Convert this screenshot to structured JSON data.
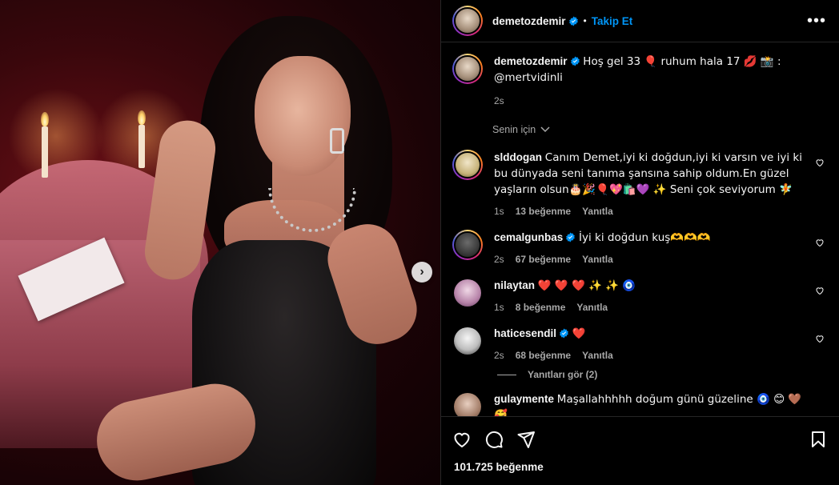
{
  "post": {
    "username": "demetozdemir",
    "follow_label": "Takip Et",
    "separator": "•",
    "more_label": "•••",
    "caption": "Hoş gel 33 🎈 ruhum hala 17 💋 📸 : @mertvidinli",
    "caption_time": "2s",
    "for_you_label": "Senin için",
    "likes_text": "101.725 beğenme",
    "next_label": "›"
  },
  "comments": [
    {
      "username": "slddogan",
      "verified": false,
      "text": "Canım Demet,iyi ki doğdun,iyi ki varsın ve iyi ki bu dünyada seni tanıma şansına sahip oldum.En güzel yaşların olsun🎂🎉🎈💖🛍️💜 ✨ Seni çok seviyorum 🧚",
      "time": "1s",
      "likes": "13 beğenme",
      "reply": "Yanıtla"
    },
    {
      "username": "cemalgunbas",
      "verified": true,
      "text": "İyi ki doğdun kuş🫶🫶🫶",
      "time": "2s",
      "likes": "67 beğenme",
      "reply": "Yanıtla"
    },
    {
      "username": "nilaytan",
      "verified": false,
      "text": "❤️ ❤️ ❤️ ✨ ✨ 🧿",
      "time": "1s",
      "likes": "8 beğenme",
      "reply": "Yanıtla"
    },
    {
      "username": "haticesendil",
      "verified": true,
      "text": "❤️",
      "time": "2s",
      "likes": "68 beğenme",
      "reply": "Yanıtla"
    },
    {
      "username": "gulaymente",
      "verified": false,
      "text": "Maşallahhhhh doğum günü güzeline 🧿 😊 🤎 🥰",
      "time": "",
      "likes": "",
      "reply": ""
    }
  ],
  "view_replies": "Yanıtları gör (2)",
  "colors": {
    "accent_blue": "#0095f6",
    "background": "#000000",
    "text_primary": "#f5f5f5",
    "text_secondary": "#a8a8a8",
    "divider": "#262626"
  },
  "icons": [
    "more-icon",
    "verified-icon",
    "heart-icon",
    "comment-icon",
    "share-icon",
    "bookmark-icon",
    "chevron-down-icon",
    "chevron-right-icon"
  ]
}
